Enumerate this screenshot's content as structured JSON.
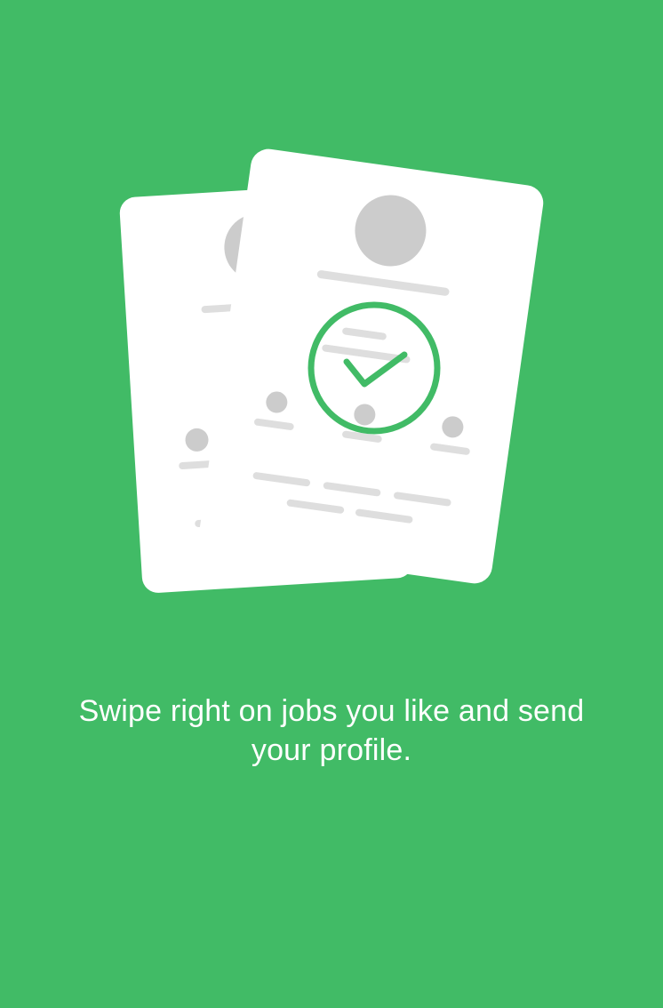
{
  "onboarding": {
    "caption": "Swipe right on jobs you like and send your profile.",
    "illustration_icon": "swipe-cards-checkmark-icon"
  },
  "colors": {
    "background": "#41BB66",
    "card": "#FFFFFF",
    "placeholder_dark": "#CCCCCC",
    "placeholder_light": "#DEDEDE",
    "accent": "#41BB66"
  }
}
